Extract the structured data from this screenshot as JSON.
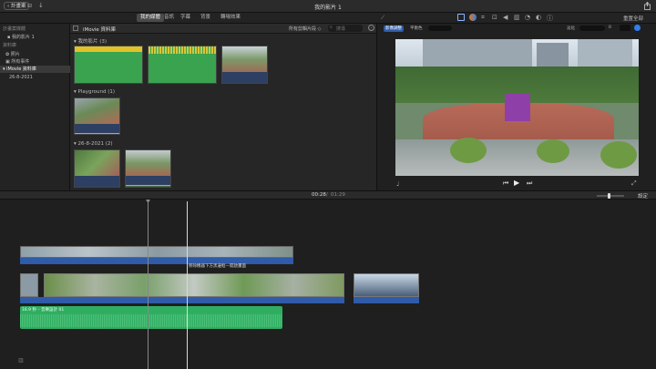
{
  "app": {
    "back_label": "‹ 計畫案",
    "title": "我的影片 1",
    "share_icon": "share-icon"
  },
  "toolbar": {
    "tabs": [
      "我的媒體",
      "音訊",
      "字幕",
      "背景",
      "轉場效果"
    ],
    "active_tab": "我的媒體",
    "reset_all": "重置全部"
  },
  "sidebar": {
    "section_projects": "計畫案媒體",
    "project_item": "我的影片 1",
    "section_libraries": "資料庫",
    "photos": "照片",
    "all_events": "所有事件",
    "library": "iMovie 資料庫",
    "event_date": "26-8-2021"
  },
  "browser": {
    "title": "iMovie 資料庫",
    "filter_label": "所有剪輯片段 ◇",
    "search_placeholder": "搜尋",
    "sections": [
      {
        "label": "我的影片",
        "count": "(3)"
      },
      {
        "label": "Playground",
        "count": "(1)"
      },
      {
        "label": "26-8-2021",
        "count": "(2)"
      }
    ]
  },
  "viewer": {
    "auto_label": "影像調整",
    "toggle_label": "平衡色",
    "field_label": "淡化",
    "field_value": "0"
  },
  "timeline": {
    "current_time": "00:28",
    "total_time": "01:29",
    "separator": "/",
    "settings_label": "設定",
    "title_clip_label": "移除機器下方黑邊框—開啟畫面",
    "audio_clip_label": "16.9 秒 – 音樂設計 01"
  },
  "colors": {
    "accent_blue": "#2f5ba8",
    "audio_green": "#2fae62",
    "title_purple": "#3d3070",
    "playhead": "#d8d8d8"
  }
}
